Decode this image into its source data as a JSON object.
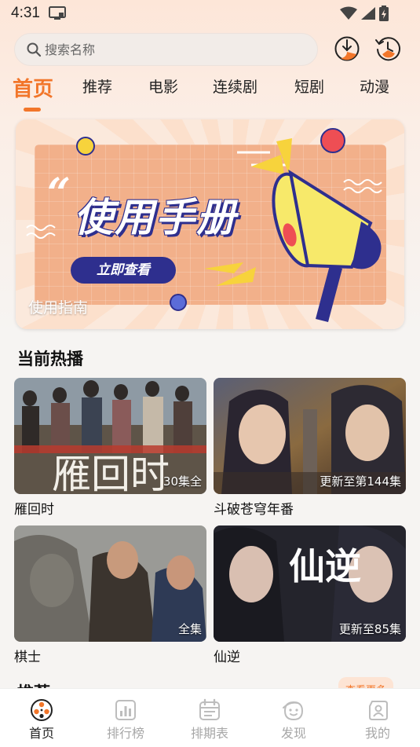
{
  "status_bar": {
    "time": "4:31"
  },
  "search": {
    "placeholder": "搜索名称"
  },
  "tabs": [
    {
      "label": "首页",
      "active": true
    },
    {
      "label": "推荐",
      "active": false
    },
    {
      "label": "电影",
      "active": false
    },
    {
      "label": "连续剧",
      "active": false
    },
    {
      "label": "短剧",
      "active": false
    },
    {
      "label": "动漫",
      "active": false
    }
  ],
  "banner": {
    "heading": "使用手册",
    "button": "立即查看",
    "caption": "使用指南"
  },
  "hot_section": {
    "title": "当前热播",
    "items": [
      {
        "title": "雁回时",
        "badge": "30集全",
        "art_text": "雁回时"
      },
      {
        "title": "斗破苍穹年番",
        "badge": "更新至第144集"
      },
      {
        "title": "棋士",
        "badge": "全集"
      },
      {
        "title": "仙逆",
        "badge": "更新至85集",
        "art_text": "仙逆"
      }
    ]
  },
  "next_section": {
    "title": "推荐",
    "more": "查看更多"
  },
  "bottom_nav": [
    {
      "label": "首页",
      "icon": "film-reel-icon",
      "active": true
    },
    {
      "label": "排行榜",
      "icon": "bar-chart-icon",
      "active": false
    },
    {
      "label": "排期表",
      "icon": "calendar-icon",
      "active": false
    },
    {
      "label": "发现",
      "icon": "discover-face-icon",
      "active": false
    },
    {
      "label": "我的",
      "icon": "profile-icon",
      "active": false
    }
  ],
  "colors": {
    "accent": "#f2762a",
    "navy": "#2e2f8e",
    "inactive": "#a7a7a7"
  }
}
